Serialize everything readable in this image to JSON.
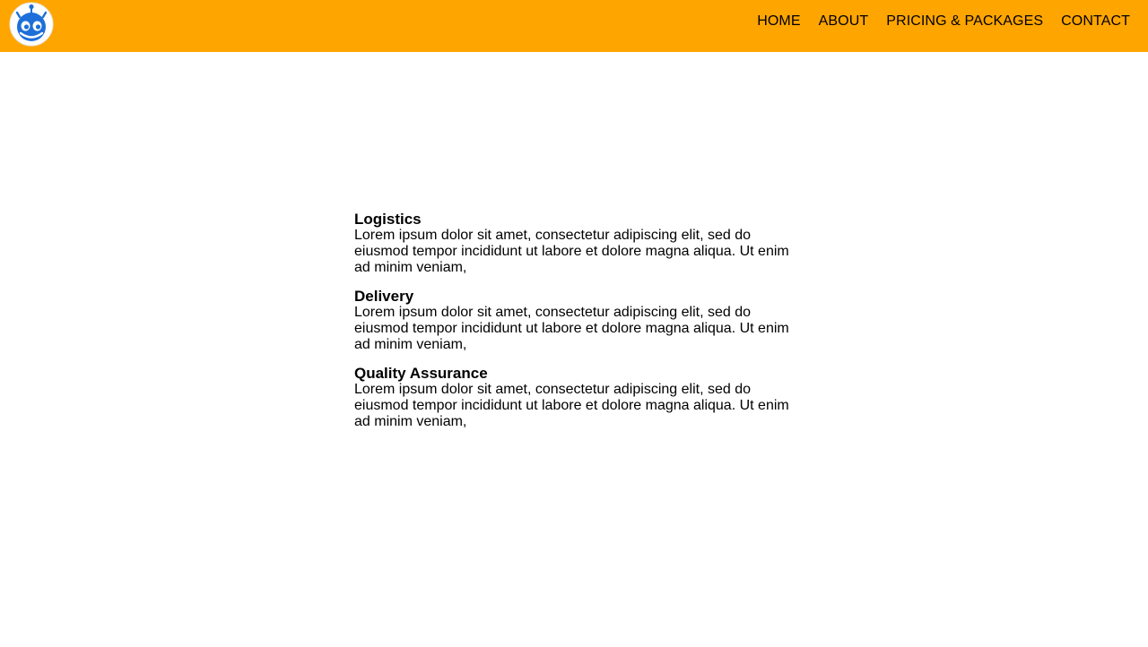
{
  "header": {
    "bg_color": "#FFA500",
    "logo_icon": "robot-icon",
    "nav": [
      {
        "label": "HOME"
      },
      {
        "label": "ABOUT"
      },
      {
        "label": "PRICING & PACKAGES"
      },
      {
        "label": "CONTACT"
      }
    ]
  },
  "main": {
    "items": [
      {
        "title": "Logistics",
        "text": "Lorem ipsum dolor sit amet, consectetur adipiscing elit, sed do eiusmod tempor incididunt ut labore et dolore magna aliqua. Ut enim ad minim veniam,"
      },
      {
        "title": "Delivery",
        "text": "Lorem ipsum dolor sit amet, consectetur adipiscing elit, sed do eiusmod tempor incididunt ut labore et dolore magna aliqua. Ut enim ad minim veniam,"
      },
      {
        "title": "Quality Assurance",
        "text": "Lorem ipsum dolor sit amet, consectetur adipiscing elit, sed do eiusmod tempor incididunt ut labore et dolore magna aliqua. Ut enim ad minim veniam,"
      }
    ]
  }
}
